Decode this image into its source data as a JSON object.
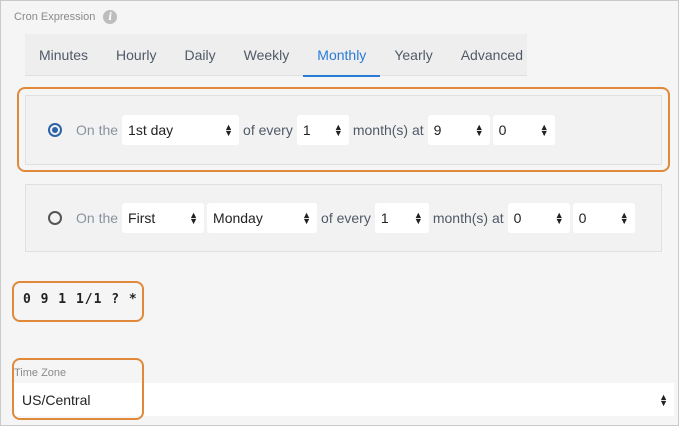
{
  "header": {
    "title": "Cron Expression",
    "info_icon": "i"
  },
  "tabs": [
    {
      "label": "Minutes"
    },
    {
      "label": "Hourly"
    },
    {
      "label": "Daily"
    },
    {
      "label": "Weekly"
    },
    {
      "label": "Monthly",
      "active": true
    },
    {
      "label": "Yearly"
    },
    {
      "label": "Advanced"
    }
  ],
  "option1": {
    "selected": true,
    "prefix": "On the",
    "day_value": "1st day",
    "of_every": "of every",
    "month_interval": "1",
    "months_at": "month(s) at",
    "hour": "9",
    "minute": "0"
  },
  "option2": {
    "selected": false,
    "prefix": "On the",
    "ordinal": "First",
    "weekday": "Monday",
    "of_every": "of every",
    "month_interval": "1",
    "months_at": "month(s) at",
    "hour": "0",
    "minute": "0"
  },
  "cron_expression": "0 9 1 1/1 ? *",
  "timezone": {
    "label": "Time Zone",
    "value": "US/Central"
  },
  "colors": {
    "accent": "#2a7bd6",
    "highlight": "#e0893a",
    "radio": "#2c63a8"
  },
  "icons": {
    "info": "info-icon",
    "select_arrows": "up-down-arrows-icon"
  }
}
